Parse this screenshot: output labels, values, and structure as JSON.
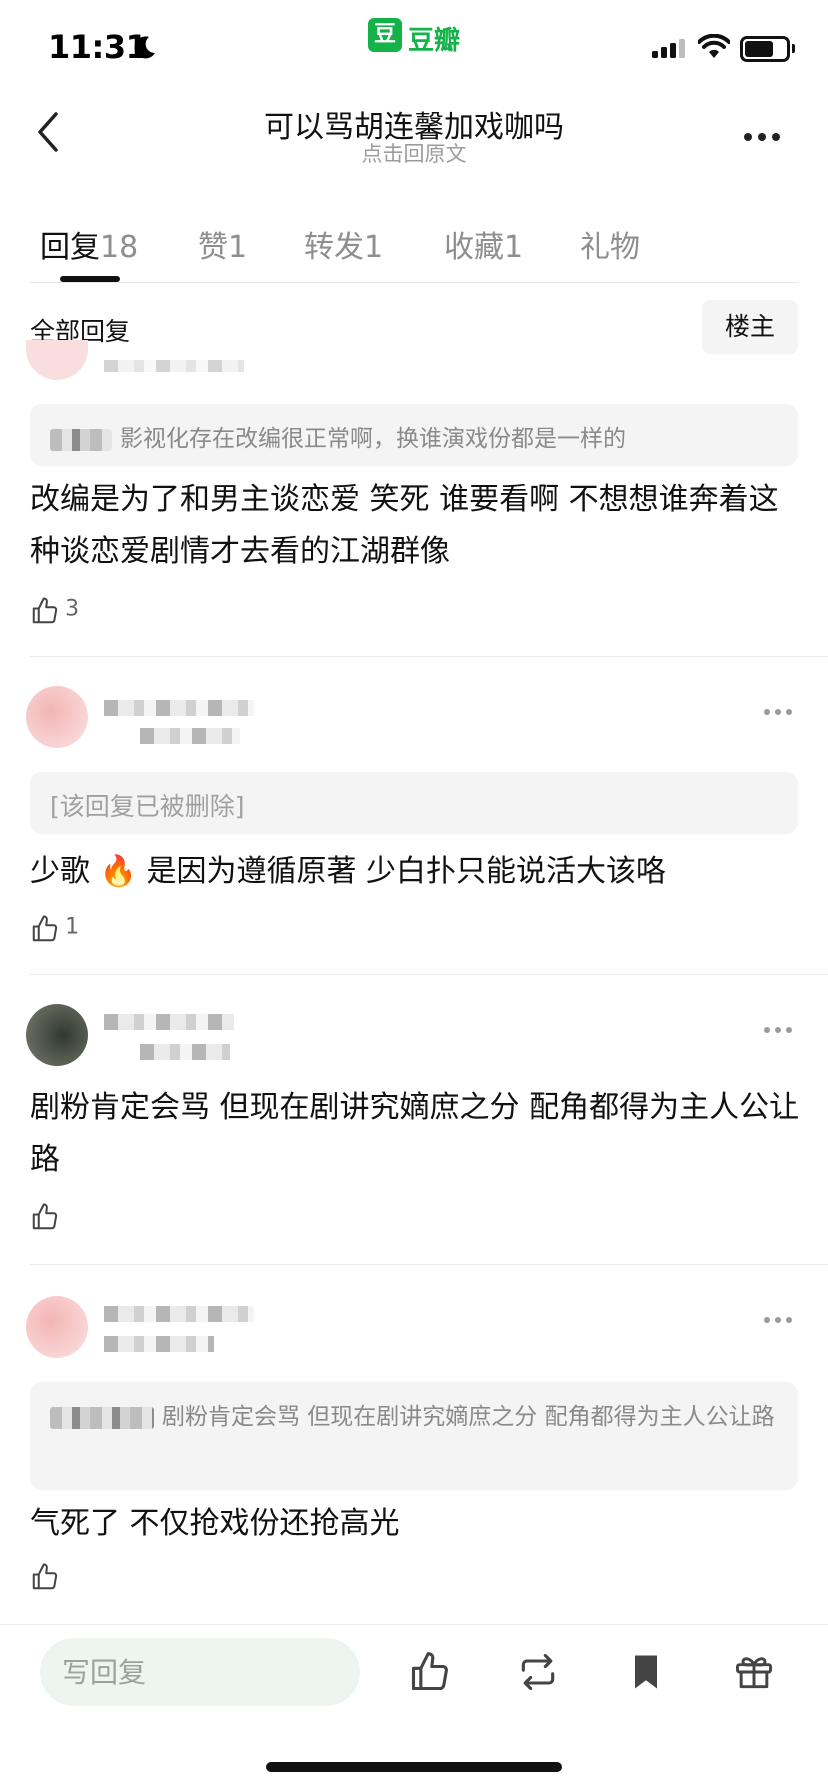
{
  "status_bar": {
    "time": "11:31",
    "app_badge": "豆",
    "app_name": "豆瓣"
  },
  "nav": {
    "title": "可以骂胡连馨加戏咖吗",
    "subtitle": "点击回原文"
  },
  "tabs": [
    {
      "label": "回复",
      "count": "18",
      "active": true
    },
    {
      "label": "赞",
      "count": "1"
    },
    {
      "label": "转发",
      "count": "1"
    },
    {
      "label": "收藏",
      "count": "1"
    },
    {
      "label": "礼物",
      "count": ""
    }
  ],
  "filter": {
    "label": "全部回复",
    "op_button": "楼主"
  },
  "comments": [
    {
      "quote": "影视化存在改编很正常啊，换谁演戏份都是一样的",
      "text": "改编是为了和男主谈恋爱 笑死 谁要看啊 不想想谁奔着这种谈恋爱剧情才去看的江湖群像",
      "likes": "3"
    },
    {
      "quote": "[该回复已被删除]",
      "text_before": "少歌",
      "emoji": "🔥",
      "text_after": "是因为遵循原著 少白扑只能说活大该咯",
      "likes": "1"
    },
    {
      "text": "剧粉肯定会骂 但现在剧讲究嫡庶之分 配角都得为主人公让路",
      "likes": ""
    },
    {
      "quote": "剧粉肯定会骂 但现在剧讲究嫡庶之分 配角都得为主人公让路",
      "text": "气死了 不仅抢戏份还抢高光",
      "likes": ""
    }
  ],
  "bottom_bar": {
    "reply_placeholder": "写回复"
  },
  "colors": {
    "brand": "#13b34a",
    "input_bg": "#eef4ef"
  }
}
